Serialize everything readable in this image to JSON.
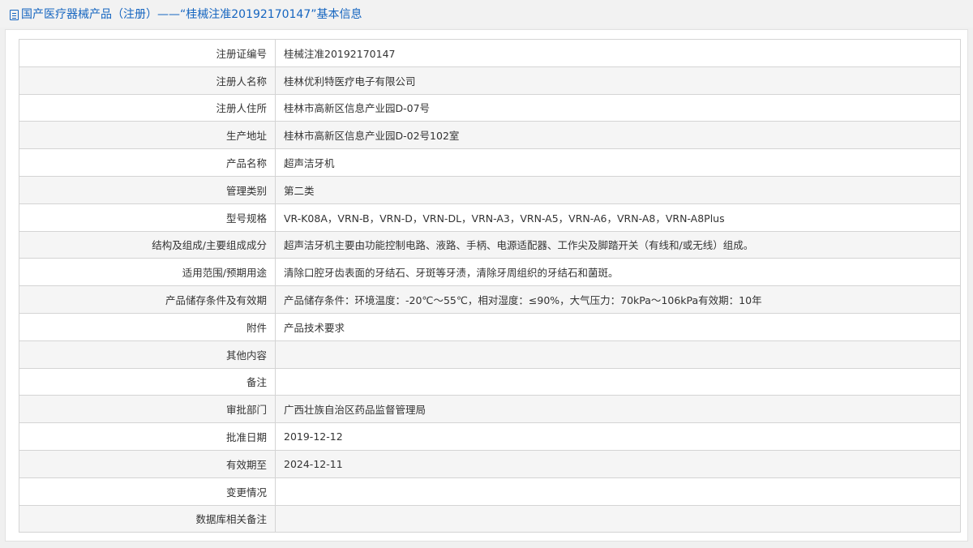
{
  "header": {
    "title": "国产医疗器械产品（注册）——“桂械注准20192170147”基本信息",
    "icon": "document-icon",
    "color": "#1565c0"
  },
  "rows": [
    {
      "label": "注册证编号",
      "value": "桂械注准20192170147"
    },
    {
      "label": "注册人名称",
      "value": "桂林优利特医疗电子有限公司"
    },
    {
      "label": "注册人住所",
      "value": "桂林市高新区信息产业园D-07号"
    },
    {
      "label": "生产地址",
      "value": "桂林市高新区信息产业园D-02号102室"
    },
    {
      "label": "产品名称",
      "value": "超声洁牙机"
    },
    {
      "label": "管理类别",
      "value": "第二类"
    },
    {
      "label": "型号规格",
      "value": "VR-K08A，VRN-B，VRN-D，VRN-DL，VRN-A3，VRN-A5，VRN-A6，VRN-A8，VRN-A8Plus"
    },
    {
      "label": "结构及组成/主要组成成分",
      "value": "超声洁牙机主要由功能控制电路、液路、手柄、电源适配器、工作尖及脚踏开关（有线和/或无线）组成。"
    },
    {
      "label": "适用范围/预期用途",
      "value": "清除口腔牙齿表面的牙结石、牙斑等牙渍，清除牙周组织的牙结石和菌斑。"
    },
    {
      "label": "产品储存条件及有效期",
      "value": "产品储存条件：环境温度：-20℃～55℃，相对湿度：≤90%，大气压力：70kPa～106kPa有效期：10年"
    },
    {
      "label": "附件",
      "value": "产品技术要求"
    },
    {
      "label": "其他内容",
      "value": ""
    },
    {
      "label": "备注",
      "value": ""
    },
    {
      "label": "审批部门",
      "value": "广西壮族自治区药品监督管理局"
    },
    {
      "label": "批准日期",
      "value": "2019-12-12"
    },
    {
      "label": "有效期至",
      "value": "2024-12-11"
    },
    {
      "label": "变更情况",
      "value": ""
    },
    {
      "label": "数据库相关备注",
      "value": ""
    }
  ]
}
